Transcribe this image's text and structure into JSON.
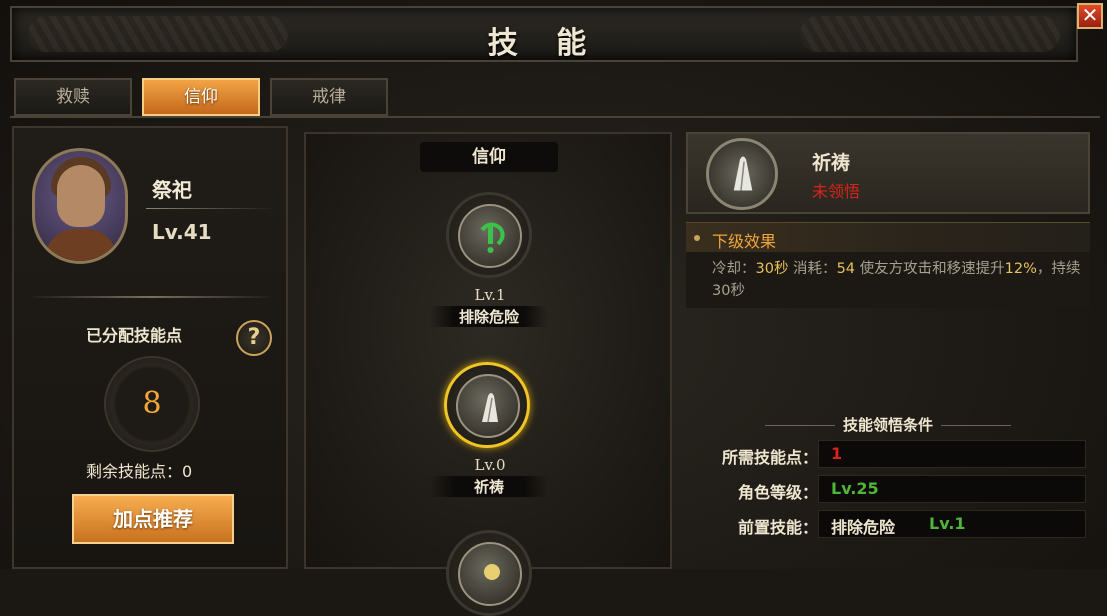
{
  "window": {
    "title": "技 能",
    "close_glyph": "✕"
  },
  "tabs": [
    {
      "label": "救赎",
      "active": false
    },
    {
      "label": "信仰",
      "active": true
    },
    {
      "label": "戒律",
      "active": false
    }
  ],
  "character": {
    "name": "祭祀",
    "level": "Lv.41"
  },
  "points": {
    "allocated_label": "已分配技能点",
    "allocated_value": "8",
    "remaining_text": "剩余技能点：0",
    "help_glyph": "?",
    "recommend_label": "加点推荐"
  },
  "tree": {
    "header": "信仰",
    "nodes": [
      {
        "level": "Lv.1",
        "name": "排除危险",
        "icon": "danger-exclaim-icon",
        "selected": false
      },
      {
        "level": "Lv.0",
        "name": "祈祷",
        "icon": "praying-hands-icon",
        "selected": true
      },
      {
        "level": "",
        "name": "",
        "icon": "light-icon",
        "selected": false
      }
    ]
  },
  "detail": {
    "name": "祈祷",
    "status": "未领悟",
    "effect_title": "下级效果",
    "effect_parts": {
      "p1": "冷却：",
      "cooldown": "30秒",
      "p2": " 消耗：",
      "cost": "54",
      "p3": " 使友方攻击和移速提升",
      "boost": "12%",
      "p4": "，持续30秒"
    },
    "conditions_title": "技能领悟条件",
    "conditions": [
      {
        "label": "所需技能点：",
        "value": "1",
        "value2": ""
      },
      {
        "label": "角色等级：",
        "value": "Lv.25",
        "value2": ""
      },
      {
        "label": "前置技能：",
        "value": "排除危险",
        "value2": "Lv.1"
      }
    ]
  },
  "colors": {
    "accent_orange": "#f5a638",
    "status_red": "#d8231c",
    "level_green": "#4fb637",
    "selected_ring": "#f0c524"
  }
}
